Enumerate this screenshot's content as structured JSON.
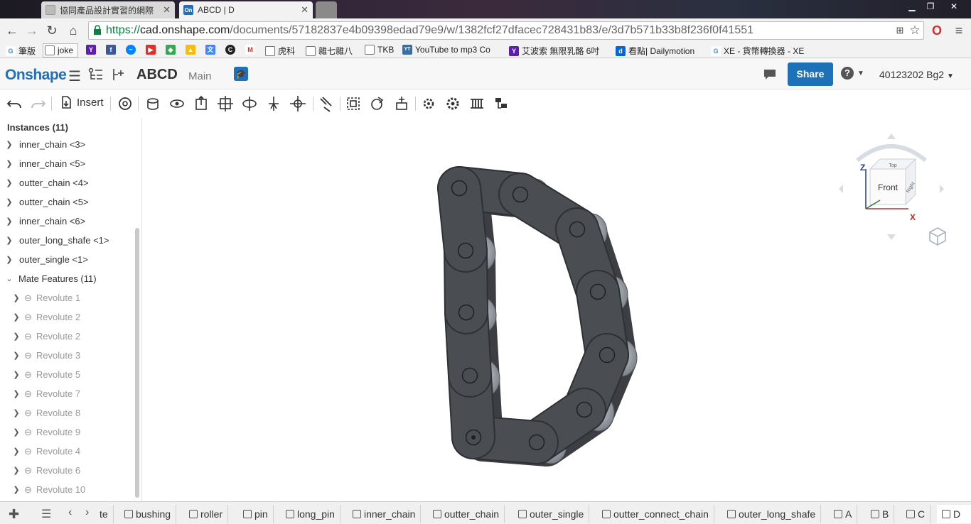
{
  "browser": {
    "tabs": [
      {
        "title": "協同產品設計實習的網際",
        "active": false
      },
      {
        "title": "ABCD | D",
        "active": true
      }
    ],
    "url_scheme": "https://",
    "url_host": "cad.onshape.com",
    "url_path": "/documents/57182837e4b09398edad79e9/w/1382fcf27dfacec728431b83/e/3d7b571b33b8f236f0f41551",
    "bookmarks": [
      "筆版",
      "joke",
      "",
      "",
      "",
      "",
      "",
      "",
      "",
      "",
      "",
      "虎科",
      "雜七雜八",
      "TKB",
      "YouTube to mp3 Co",
      "艾波索 無限乳酪 6吋",
      "看點| Dailymotion",
      "XE - 貨幣轉換器 - XE"
    ]
  },
  "app": {
    "logo": "Onshape",
    "document": "ABCD",
    "workspace": "Main",
    "share_label": "Share",
    "help_label": "?",
    "user": "40123202 Bg2"
  },
  "toolbar": {
    "insert_label": "Insert"
  },
  "panel": {
    "instances_header": "Instances (11)",
    "instances": [
      "inner_chain <3>",
      "inner_chain <5>",
      "outter_chain <4>",
      "outter_chain <5>",
      "inner_chain <6>",
      "outer_long_shafe <1>",
      "outer_single <1>"
    ],
    "mate_header": "Mate Features (11)",
    "mates": [
      "Revolute 1",
      "Revolute 2",
      "Revolute 2",
      "Revolute 3",
      "Revolute 5",
      "Revolute 7",
      "Revolute 8",
      "Revolute 9",
      "Revolute 4",
      "Revolute 6",
      "Revolute 10"
    ]
  },
  "viewcube": {
    "face_front": "Front",
    "face_top": "Top",
    "face_right": "Right",
    "axis_z": "Z",
    "axis_x": "X"
  },
  "bottom_tabs": [
    "te",
    "bushing",
    "roller",
    "pin",
    "long_pin",
    "inner_chain",
    "outter_chain",
    "outer_single",
    "outter_connect_chain",
    "outer_long_shafe",
    "A",
    "B",
    "C",
    "D"
  ],
  "colors": {
    "brand": "#1f6fba",
    "share_bg": "#1d71b8",
    "link_plate": "#4a4d52",
    "link_edge": "#2e3034"
  }
}
